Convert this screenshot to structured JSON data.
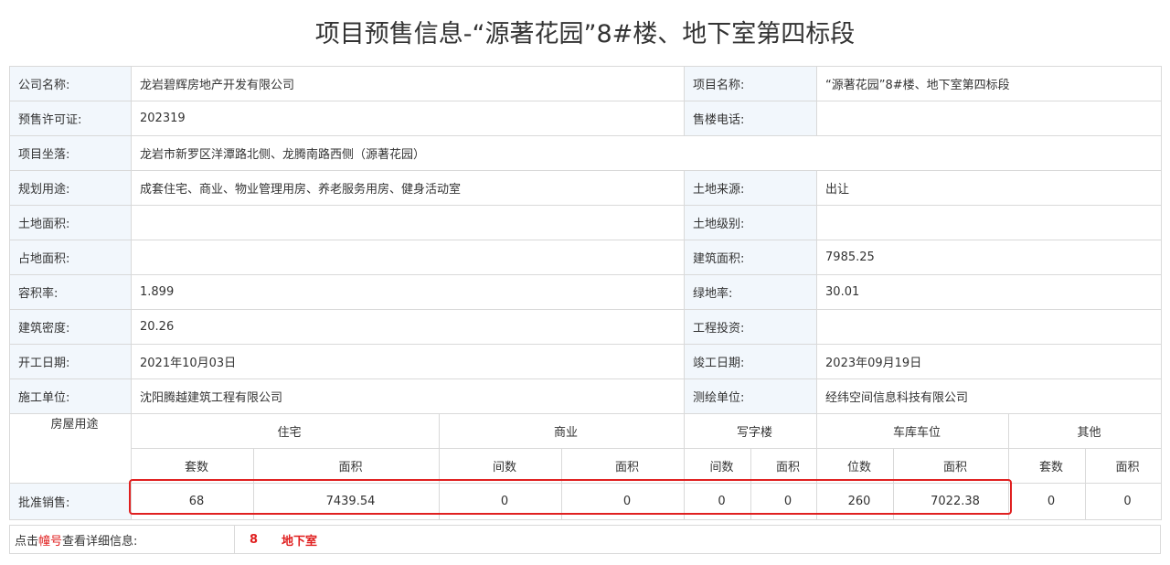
{
  "title": "项目预售信息-“源著花园”8#楼、地下室第四标段",
  "rows": [
    {
      "l1": "公司名称:",
      "v1": "龙岩碧辉房地产开发有限公司",
      "l2": "项目名称:",
      "v2": "“源著花园”8#楼、地下室第四标段"
    },
    {
      "l1": "预售许可证:",
      "v1": "202319",
      "l2": "售楼电话:",
      "v2": ""
    },
    {
      "l1": "项目坐落:",
      "v1": "龙岩市新罗区洋潭路北侧、龙腾南路西侧（源著花园）"
    },
    {
      "l1": "规划用途:",
      "v1": "成套住宅、商业、物业管理用房、养老服务用房、健身活动室",
      "l2": "土地来源:",
      "v2": "出让"
    },
    {
      "l1": "土地面积:",
      "v1": "",
      "l2": "土地级别:",
      "v2": ""
    },
    {
      "l1": "占地面积:",
      "v1": "",
      "l2": "建筑面积:",
      "v2": "7985.25"
    },
    {
      "l1": "容积率:",
      "v1": "1.899",
      "l2": "绿地率:",
      "v2": "30.01"
    },
    {
      "l1": "建筑密度:",
      "v1": "20.26",
      "l2": "工程投资:",
      "v2": ""
    },
    {
      "l1": "开工日期:",
      "v1": "2021年10月03日",
      "l2": "竣工日期:",
      "v2": "2023年09月19日"
    },
    {
      "l1": "施工单位:",
      "v1": "沈阳腾越建筑工程有限公司",
      "l2": "测绘单位:",
      "v2": "经纬空间信息科技有限公司"
    }
  ],
  "sales": {
    "usage_label": "房屋用途",
    "groups": [
      "住宅",
      "商业",
      "写字楼",
      "车库车位",
      "其他"
    ],
    "subheaders": [
      "套数",
      "面积",
      "间数",
      "面积",
      "间数",
      "面积",
      "位数",
      "面积",
      "套数",
      "面积"
    ],
    "row_label": "批准销售:",
    "values": [
      "68",
      "7439.54",
      "0",
      "0",
      "0",
      "0",
      "260",
      "7022.38",
      "0",
      "0"
    ]
  },
  "footer": {
    "prefix": "点击",
    "highlight": "幢号",
    "suffix": "查看详细信息:",
    "links": [
      "8",
      "地下室"
    ]
  },
  "colors": {
    "label_bg": "#f2f7fc",
    "border": "#d9d9d9",
    "accent_red": "#e02020"
  }
}
